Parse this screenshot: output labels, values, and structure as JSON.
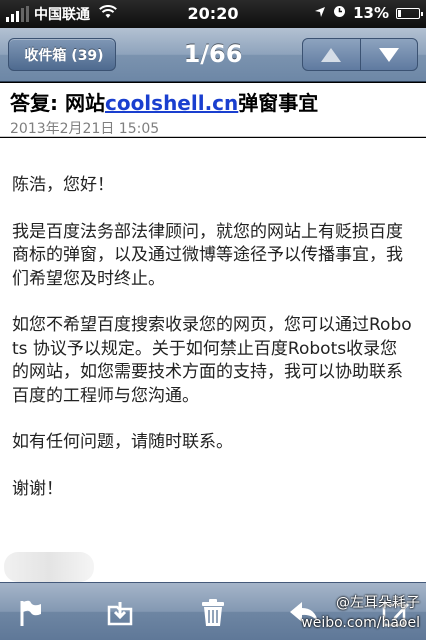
{
  "status_bar": {
    "carrier": "中国联通",
    "time": "20:20",
    "battery": "13%",
    "battery_level": 0.13,
    "signal_bars": 3
  },
  "nav": {
    "back_label": "收件箱 (39)",
    "title": "1/66",
    "prev_icon": "up-triangle-icon",
    "next_icon": "down-triangle-icon"
  },
  "message": {
    "subject_prefix": "答复: 网站",
    "subject_link": "coolshell.cn",
    "subject_suffix": "弹窗事宜",
    "date": "2013年2月21日 15:05",
    "paragraphs": [
      "陈浩，您好！",
      "我是百度法务部法律顾问，就您的网站上有贬损百度商标的弹窗，以及通过微博等途径予以传播事宜，我们希望您及时终止。",
      "如您不希望百度搜索收录您的网页，您可以通过Robots 协议予以规定。关于如何禁止百度Robots收录您的网站，如您需要技术方面的支持，我可以协助联系百度的工程师与您沟通。",
      "如有任何问题，请随时联系。",
      "谢谢！"
    ]
  },
  "toolbar": {
    "icons": [
      "flag-icon",
      "move-folder-icon",
      "trash-icon",
      "reply-icon",
      "compose-icon"
    ]
  },
  "watermark": {
    "handle": "@左耳朵耗子",
    "url": "weibo.com/haoel"
  },
  "colors": {
    "link": "#1a3fcf",
    "nav_blue": "#6d87a6"
  }
}
